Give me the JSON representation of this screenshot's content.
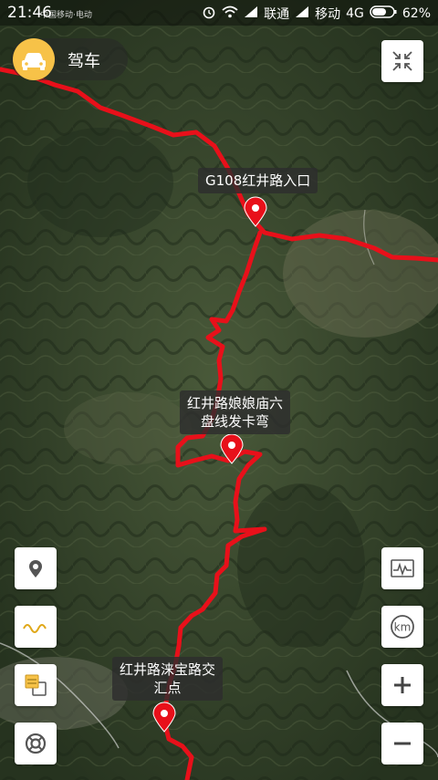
{
  "status_bar": {
    "time": "21:46",
    "carrier_small": "中国移动·电动",
    "carrier1": "联通",
    "carrier2": "移动",
    "network": "4G",
    "battery": "62%"
  },
  "mode": {
    "label": "驾车",
    "icon": "car-icon"
  },
  "map_labels": [
    {
      "text": "G108红井路入口"
    },
    {
      "text": "红井路娘娘庙六\n盘线发卡弯"
    },
    {
      "text": "红井路涞宝路交\n汇点"
    }
  ],
  "controls": {
    "left": [
      "location-pin-icon",
      "track-wave-icon",
      "layers-icon",
      "lifebuoy-icon"
    ],
    "right": [
      "elevation-chart-icon",
      "km-icon",
      "zoom-in-icon",
      "zoom-out-icon"
    ],
    "top_right": "collapse-icon"
  },
  "colors": {
    "route": "#e8101a",
    "marker": "#e8101a",
    "mode_accent": "#f7c248"
  }
}
